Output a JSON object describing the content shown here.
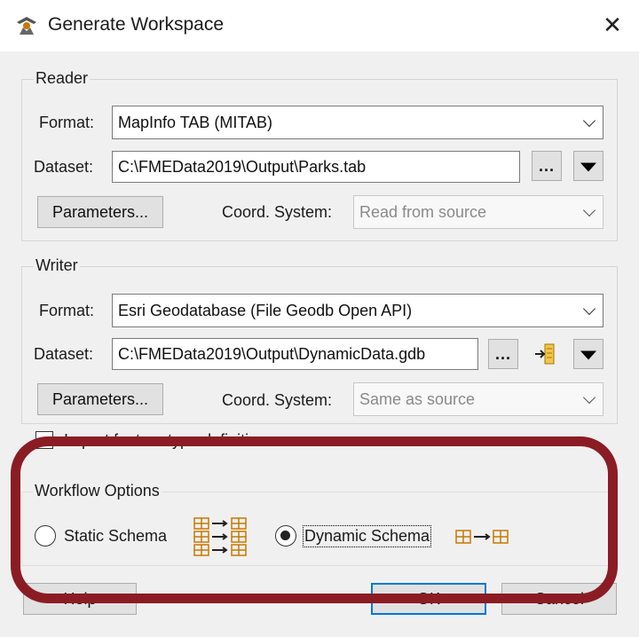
{
  "window": {
    "title": "Generate Workspace",
    "close_glyph": "✕"
  },
  "reader": {
    "group_label": "Reader",
    "format_label": "Format:",
    "format_value": "MapInfo TAB (MITAB)",
    "dataset_label": "Dataset:",
    "dataset_value": "C:\\FMEData2019\\Output\\Parks.tab",
    "browse_label": "...",
    "parameters_label": "Parameters...",
    "coord_label": "Coord. System:",
    "coord_value": "Read from source"
  },
  "writer": {
    "group_label": "Writer",
    "format_label": "Format:",
    "format_value": "Esri Geodatabase (File Geodb Open API)",
    "dataset_label": "Dataset:",
    "dataset_value": "C:\\FMEData2019\\Output\\DynamicData.gdb",
    "browse_label": "...",
    "parameters_label": "Parameters...",
    "coord_label": "Coord. System:",
    "coord_value": "Same as source"
  },
  "import_checkbox": {
    "label": "Import feature type definitions",
    "checked": false
  },
  "workflow": {
    "group_label": "Workflow Options",
    "static_label": "Static Schema",
    "dynamic_label": "Dynamic Schema",
    "selected": "Dynamic Schema"
  },
  "buttons": {
    "help": "Help",
    "ok": "OK",
    "cancel": "Cancel"
  },
  "colors": {
    "highlight": "#8c1c24",
    "focus_blue": "#0078d7",
    "icon_orange": "#c77800"
  },
  "icons": {
    "app": "fme-workbench-icon",
    "browse_special": "geodatabase-select-icon"
  }
}
